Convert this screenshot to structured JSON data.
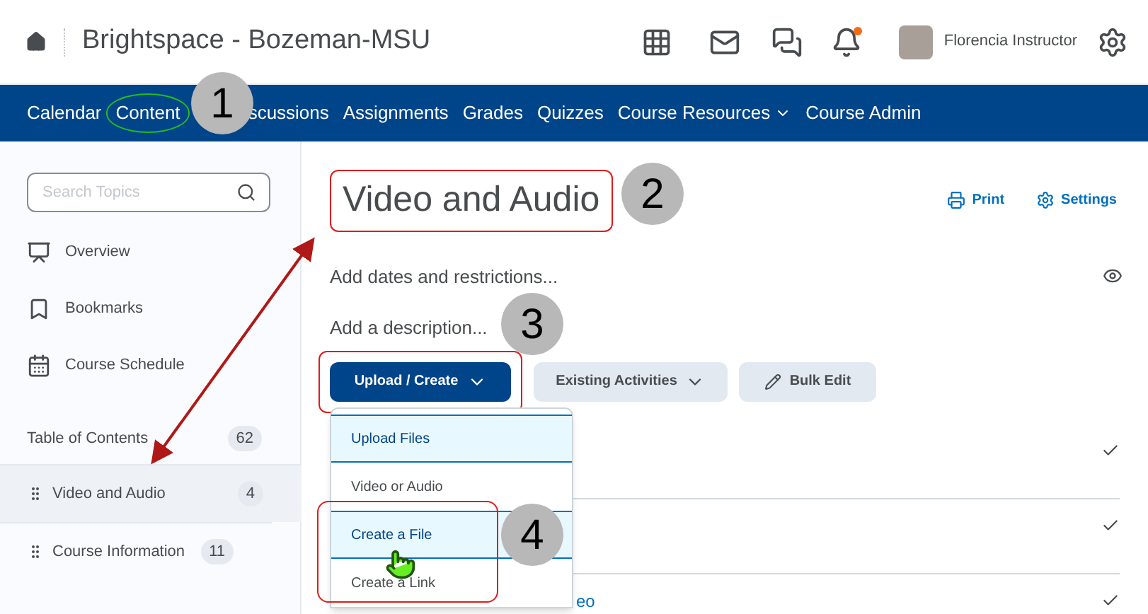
{
  "header": {
    "title": "Brightspace - Bozeman-MSU",
    "user_name": "Florencia Instructor",
    "notification_unread": true
  },
  "nav": [
    {
      "label": "Calendar",
      "kind": "link",
      "circled": false
    },
    {
      "label": "Content",
      "kind": "link",
      "circled": true
    },
    {
      "label": "scussions",
      "kind": "link",
      "circled": false
    },
    {
      "label": "Assignments",
      "kind": "link",
      "circled": false
    },
    {
      "label": "Grades",
      "kind": "link",
      "circled": false
    },
    {
      "label": "Quizzes",
      "kind": "link",
      "circled": false
    },
    {
      "label": "Course Resources",
      "kind": "dropdown",
      "circled": false
    },
    {
      "label": "Course Admin",
      "kind": "link",
      "circled": false
    }
  ],
  "sidebar": {
    "search": {
      "placeholder": "Search Topics"
    },
    "links": [
      {
        "label": "Overview",
        "kind": "overview"
      },
      {
        "label": "Bookmarks",
        "kind": "bookmark"
      },
      {
        "label": "Course Schedule",
        "kind": "calendar"
      }
    ],
    "toc": {
      "label": "Table of Contents",
      "count": "62"
    },
    "modules": [
      {
        "title": "Video and Audio",
        "count": "4",
        "selected": true
      },
      {
        "title": "Course Information",
        "count": "11",
        "selected": false
      }
    ]
  },
  "main": {
    "title": "Video and Audio",
    "actions": [
      "Print",
      "Settings"
    ],
    "dates_link": "Add dates and restrictions...",
    "description_link": "Add a description...",
    "buttons": [
      {
        "label": "Upload / Create",
        "kind": "primary"
      },
      {
        "label": "Existing Activities",
        "kind": "dropdown"
      },
      {
        "label": "Bulk Edit",
        "kind": "edit"
      }
    ],
    "menu": [
      {
        "label": "Upload Files",
        "highlighted": true
      },
      {
        "label": "Video or Audio",
        "highlighted": false
      },
      {
        "label": "Create a File",
        "highlighted": true
      },
      {
        "label": "Create a Link",
        "highlighted": false
      }
    ],
    "rows": [
      {
        "done": true
      },
      {
        "done": true
      },
      {
        "text": "eo",
        "done": true
      }
    ]
  },
  "callouts": [
    "1",
    "2",
    "3",
    "4"
  ]
}
